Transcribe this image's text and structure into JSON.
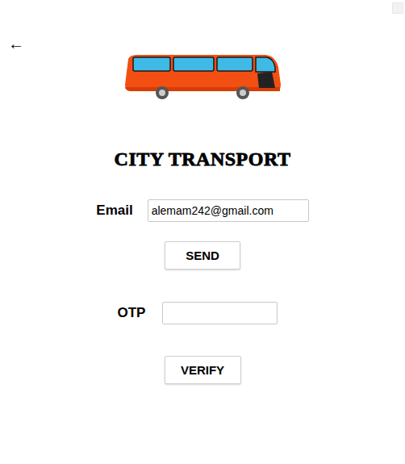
{
  "back": "←",
  "title": "CITY TRANSPORT",
  "email": {
    "label": "Email",
    "value": "alemam242@gmail.com"
  },
  "send": "SEND",
  "otp": {
    "label": "OTP",
    "value": ""
  },
  "verify": "VERIFY"
}
